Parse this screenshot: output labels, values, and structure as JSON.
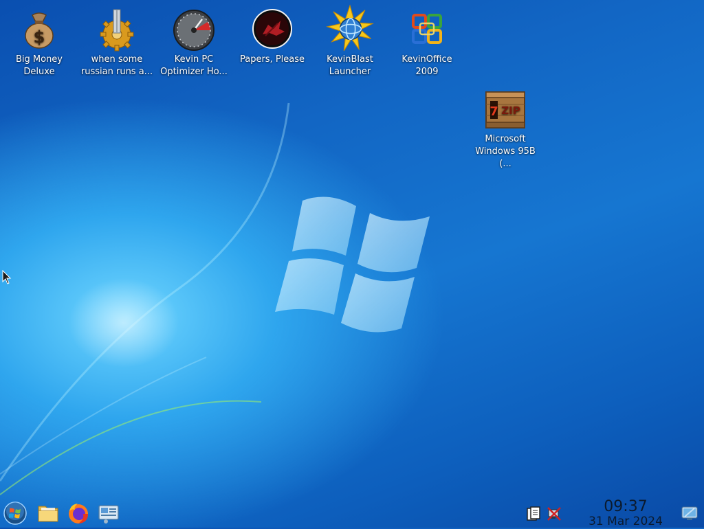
{
  "desktop": {
    "icons": [
      {
        "name": "big-money-deluxe",
        "label": "Big Money\nDeluxe",
        "icon": "money-bag-icon"
      },
      {
        "name": "when-some-russian",
        "label": "when some\nrussian runs a...",
        "icon": "gear-icon"
      },
      {
        "name": "kevin-pc-optimizer",
        "label": "Kevin PC\nOptimizer Ho...",
        "icon": "speedometer-icon"
      },
      {
        "name": "papers-please",
        "label": "Papers, Please",
        "icon": "papers-please-icon"
      },
      {
        "name": "kevinblast-launcher",
        "label": "KevinBlast\nLauncher",
        "icon": "starburst-globe-icon"
      },
      {
        "name": "kevinoffice-2009",
        "label": "KevinOffice\n2009",
        "icon": "office-logo-icon"
      },
      {
        "name": "microsoft-windows-95b",
        "label": "Microsoft\nWindows 95B (...",
        "icon": "7zip-crate-icon"
      }
    ]
  },
  "taskbar": {
    "start_button": {
      "icon": "start-orb-icon"
    },
    "launchers": [
      {
        "name": "file-manager",
        "icon": "folder-icon"
      },
      {
        "name": "firefox",
        "icon": "firefox-icon"
      },
      {
        "name": "control-panel",
        "icon": "control-panel-icon"
      }
    ],
    "tray": [
      {
        "name": "clipboard",
        "icon": "clipboard-icon"
      },
      {
        "name": "network-disconnected",
        "icon": "network-disconnected-icon"
      }
    ],
    "clock": {
      "time": "09:37",
      "date": "31 Mar 2024"
    },
    "show_desktop": {
      "icon": "show-desktop-icon"
    }
  },
  "colors": {
    "accent": "#1676d1",
    "logo": "#bfe8ff"
  }
}
